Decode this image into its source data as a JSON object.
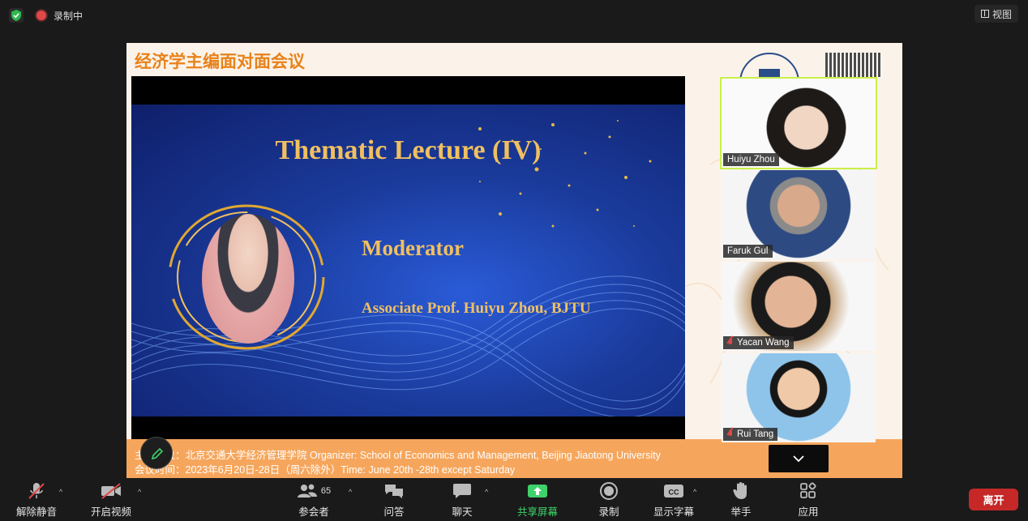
{
  "top_bar": {
    "recording_label": "录制中",
    "view_label": "视图"
  },
  "share": {
    "title": "经济学主编面对面会议",
    "slide": {
      "title": "Thematic Lecture (IV)",
      "role": "Moderator",
      "name": "Associate Prof. Huiyu Zhou, BJTU"
    },
    "footer": {
      "organizer": "主办单位：北京交通大学经济管理学院 Organizer: School of Economics and Management, Beijing Jiaotong University",
      "time": "会议时间：2023年6月20日-28日（周六除外）Time: June 20th -28th except Saturday"
    }
  },
  "participants": [
    {
      "name": "Huiyu Zhou",
      "muted": false,
      "speaking": true
    },
    {
      "name": "Faruk Gul",
      "muted": false,
      "speaking": false
    },
    {
      "name": "Yacan Wang",
      "muted": true,
      "speaking": false
    },
    {
      "name": "Rui Tang",
      "muted": true,
      "speaking": false
    }
  ],
  "toolbar": {
    "unmute": "解除静音",
    "start_video": "开启视频",
    "participants": "参会者",
    "participants_count": "65",
    "qa": "问答",
    "chat": "聊天",
    "share_screen": "共享屏幕",
    "record": "录制",
    "captions": "显示字幕",
    "captions_icon_text": "CC",
    "raise_hand": "举手",
    "apps": "应用",
    "leave": "离开"
  },
  "colors": {
    "share_green": "#3fd16a",
    "leave_red": "#c62828",
    "speaking_outline": "#c9f04a",
    "slide_gold": "#f0c060"
  }
}
